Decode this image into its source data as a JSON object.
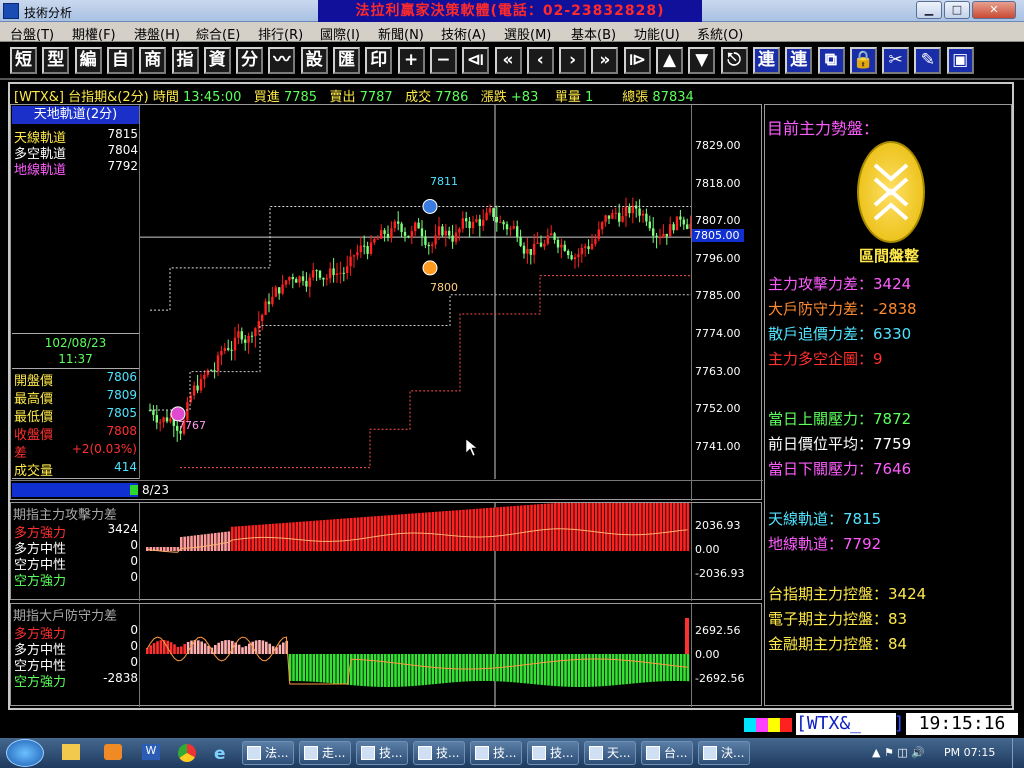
{
  "window": {
    "title": "技術分析",
    "banner": "法拉利贏家決策軟體(電話：02-23832828)",
    "min": "▁",
    "max": "□",
    "close": "✕"
  },
  "menus": [
    "台盤(T)",
    "期權(F)",
    "港盤(H)",
    "綜合(E)",
    "排行(R)",
    "國際(I)",
    "新聞(N)",
    "技術(A)",
    "選股(M)",
    "基本(B)",
    "功能(U)",
    "系統(O)"
  ],
  "toolbar": [
    {
      "icon": "短",
      "name": "tb-short"
    },
    {
      "icon": "型",
      "name": "tb-pattern"
    },
    {
      "icon": "編",
      "name": "tb-edit"
    },
    {
      "icon": "自",
      "name": "tb-custom"
    },
    {
      "icon": "商",
      "name": "tb-commodity"
    },
    {
      "icon": "指",
      "name": "tb-index"
    },
    {
      "icon": "資",
      "name": "tb-data"
    },
    {
      "icon": "分",
      "name": "tb-minute"
    },
    {
      "icon": "〰",
      "name": "tb-line"
    },
    {
      "icon": "設",
      "name": "tb-settings"
    },
    {
      "icon": "匯",
      "name": "tb-export"
    },
    {
      "icon": "印",
      "name": "tb-print"
    },
    {
      "icon": "+",
      "name": "tb-zoom-in"
    },
    {
      "icon": "−",
      "name": "tb-zoom-out"
    },
    {
      "icon": "⧏",
      "name": "tb-first"
    },
    {
      "icon": "«",
      "name": "tb-rewind"
    },
    {
      "icon": "‹",
      "name": "tb-prev"
    },
    {
      "icon": "›",
      "name": "tb-next"
    },
    {
      "icon": "»",
      "name": "tb-forward"
    },
    {
      "icon": "⧐",
      "name": "tb-last"
    },
    {
      "icon": "▲",
      "name": "tb-up"
    },
    {
      "icon": "▼",
      "name": "tb-down"
    },
    {
      "icon": "⎋",
      "name": "tb-esc"
    },
    {
      "icon": "連",
      "name": "tb-link1",
      "hl": true
    },
    {
      "icon": "連",
      "name": "tb-link2",
      "hl": true
    },
    {
      "icon": "⧉",
      "name": "tb-windows",
      "hl": true
    },
    {
      "icon": "🔒",
      "name": "tb-lock",
      "hl": true
    },
    {
      "icon": "✂",
      "name": "tb-cut",
      "hl": true
    },
    {
      "icon": "✎",
      "name": "tb-pen",
      "hl": true
    },
    {
      "icon": "▣",
      "name": "tb-window",
      "hl": true
    }
  ],
  "quote": {
    "code": "[WTX&]",
    "name": "台指期&(2分)",
    "time_label": "時間",
    "time": "13:45:00",
    "bid_label": "買進",
    "bid": "7785",
    "ask_label": "賣出",
    "ask": "7787",
    "deal_label": "成交",
    "deal": "7786",
    "chg_label": "漲跌",
    "chg": "+83",
    "vol_label": "單量",
    "vol": "1",
    "total_label": "總張",
    "total": "87834"
  },
  "indicator": {
    "title": "天地軌道(2分)",
    "rows": [
      {
        "label": "天線軌道",
        "value": "7815"
      },
      {
        "label": "多空軌道",
        "value": "7804"
      },
      {
        "label": "地線軌道",
        "value": "7792"
      }
    ]
  },
  "info": {
    "date": "102/08/23",
    "time": "11:37",
    "rows": [
      {
        "label": "開盤價",
        "value": "7806"
      },
      {
        "label": "最高價",
        "value": "7809"
      },
      {
        "label": "最低價",
        "value": "7805"
      },
      {
        "label": "收盤價",
        "value": "7808"
      },
      {
        "label": "差",
        "value": "+2(0.03%)"
      },
      {
        "label": "成交量",
        "value": "414"
      }
    ]
  },
  "main_axis": {
    "labels": [
      "7829.00",
      "7818.00",
      "7807.00",
      "7796.00",
      "7785.00",
      "7774.00",
      "7763.00",
      "7752.00",
      "7741.00"
    ],
    "current": "7805.00",
    "date": "8/23"
  },
  "annotations": {
    "high": "7811",
    "mid": "7800",
    "low": "7767"
  },
  "sub1": {
    "title": "期指主力攻擊力差",
    "rows": [
      {
        "label": "多方強力",
        "value": "3424"
      },
      {
        "label": "多方中性",
        "value": "0"
      },
      {
        "label": "空方中性",
        "value": "0"
      },
      {
        "label": "空方強力",
        "value": "0"
      }
    ],
    "axis": [
      "2036.93",
      "0.00",
      "-2036.93"
    ]
  },
  "sub2": {
    "title": "期指大戶防守力差",
    "rows": [
      {
        "label": "多方強力",
        "value": "0"
      },
      {
        "label": "多方中性",
        "value": "0"
      },
      {
        "label": "空方中性",
        "value": "0"
      },
      {
        "label": "空方強力",
        "value": "-2838"
      }
    ],
    "axis": [
      "2692.56",
      "0.00",
      "-2692.56"
    ]
  },
  "right": {
    "heading": "目前主力勢盤：",
    "badge": "區間盤整",
    "g1": [
      {
        "label": "主力攻擊力差：",
        "value": "3424"
      },
      {
        "label": "大戶防守力差：",
        "value": "-2838"
      },
      {
        "label": "散戶追價力差：",
        "value": "6330"
      },
      {
        "label": "主力多空企圖：",
        "value": "9"
      }
    ],
    "g2": [
      {
        "label": "當日上關壓力：",
        "value": "7872"
      },
      {
        "label": "前日價位平均：",
        "value": "7759"
      },
      {
        "label": "當日下關壓力：",
        "value": "7646"
      }
    ],
    "g3": [
      {
        "label": "天線軌道：",
        "value": "7815"
      },
      {
        "label": "地線軌道：",
        "value": "7792"
      }
    ],
    "g4": [
      {
        "label": "台指期主力控盤：",
        "value": "3424"
      },
      {
        "label": "電子期主力控盤：",
        "value": "83"
      },
      {
        "label": "金融期主力控盤：",
        "value": "84"
      }
    ]
  },
  "status": {
    "code": "[WTX&_",
    "bracket": "]",
    "clock": "19:15:16"
  },
  "taskbar": {
    "tasks": [
      "法...",
      "走...",
      "技...",
      "技...",
      "技...",
      "技...",
      "天...",
      "台...",
      "決..."
    ],
    "clock": "PM 07:15"
  }
}
